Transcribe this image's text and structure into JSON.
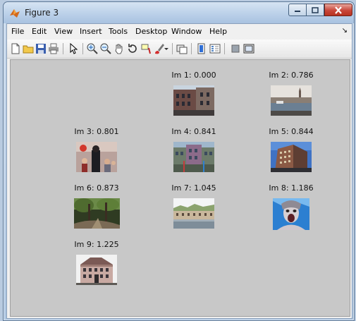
{
  "window": {
    "title": "Figure 3"
  },
  "menu": [
    "File",
    "Edit",
    "View",
    "Insert",
    "Tools",
    "Desktop",
    "Window",
    "Help"
  ],
  "toolbar_icons": [
    "new-figure-icon",
    "open-file-icon",
    "save-icon",
    "print-icon",
    "pointer-icon",
    "zoom-in-icon",
    "zoom-out-icon",
    "pan-hand-icon",
    "rotate-3d-icon",
    "data-cursor-icon",
    "brush-icon",
    "link-plot-icon",
    "colorbar-icon",
    "legend-icon",
    "hide-plot-tools-icon",
    "show-plot-tools-icon"
  ],
  "images": [
    {
      "label": "Im 1: 0.000",
      "scene": "brick-facade"
    },
    {
      "label": "Im 2: 0.786",
      "scene": "harbor-skyline"
    },
    {
      "label": "Im 3: 0.801",
      "scene": "crowd-street"
    },
    {
      "label": "Im 4: 0.841",
      "scene": "colorful-building"
    },
    {
      "label": "Im 5: 0.844",
      "scene": "modern-building"
    },
    {
      "label": "Im 6: 0.873",
      "scene": "forest"
    },
    {
      "label": "Im 7: 1.045",
      "scene": "waterfront-town"
    },
    {
      "label": "Im 8: 1.186",
      "scene": "screaming-face"
    },
    {
      "label": "Im 9: 1.225",
      "scene": "old-building"
    }
  ]
}
